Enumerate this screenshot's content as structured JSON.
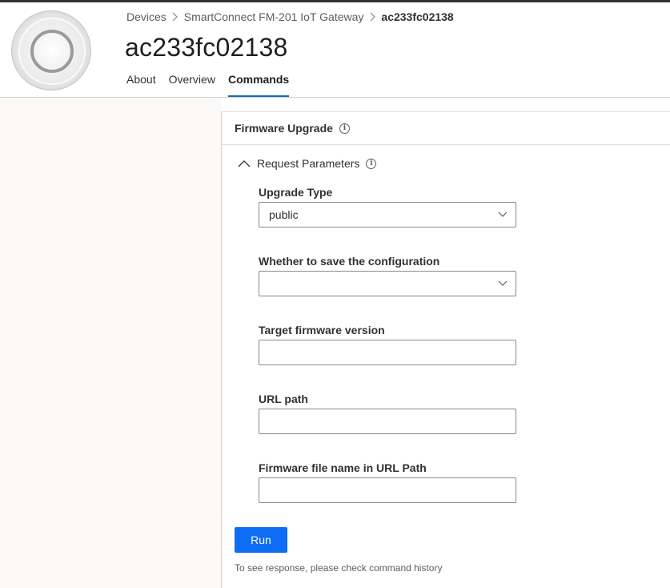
{
  "breadcrumb": {
    "items": [
      "Devices",
      "SmartConnect FM-201 IoT Gateway",
      "ac233fc02138"
    ]
  },
  "device": {
    "title": "ac233fc02138",
    "image_icon": "device-image"
  },
  "tabs": [
    {
      "label": "About",
      "active": false
    },
    {
      "label": "Overview",
      "active": false
    },
    {
      "label": "Commands",
      "active": true
    }
  ],
  "command": {
    "title": "Firmware Upgrade",
    "section_label": "Request Parameters",
    "fields": [
      {
        "label": "Upgrade Type",
        "type": "dropdown",
        "value": "public"
      },
      {
        "label": "Whether to save the configuration",
        "type": "dropdown",
        "value": ""
      },
      {
        "label": "Target firmware version",
        "type": "text",
        "value": ""
      },
      {
        "label": "URL path",
        "type": "text",
        "value": ""
      },
      {
        "label": "Firmware file name in URL Path",
        "type": "text",
        "value": ""
      }
    ],
    "run_label": "Run",
    "hint": "To see response, please check command history"
  },
  "colors": {
    "accent": "#0f6cbd",
    "run_button": "#0f6cf5",
    "left_pane": "#faf9f8"
  }
}
